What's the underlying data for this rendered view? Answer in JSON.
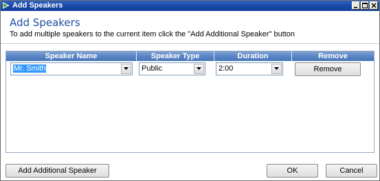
{
  "window": {
    "title": "Add Speakers"
  },
  "header": {
    "heading": "Add Speakers",
    "instructions": "To add multiple speakers to the current item click the \"Add Additional Speaker\" button"
  },
  "table": {
    "columns": [
      "Speaker Name",
      "Speaker Type",
      "Duration",
      "Remove"
    ],
    "rows": [
      {
        "speaker_name": "Mr. Smith",
        "speaker_type": "Public",
        "duration": "2:00",
        "remove_label": "Remove"
      }
    ]
  },
  "footer": {
    "add_label": "Add Additional Speaker",
    "ok_label": "OK",
    "cancel_label": "Cancel"
  },
  "colors": {
    "titlebar": "#1848a8",
    "heading": "#1f4ea0",
    "column_header": "#5b86c4",
    "selection": "#3399ff"
  }
}
